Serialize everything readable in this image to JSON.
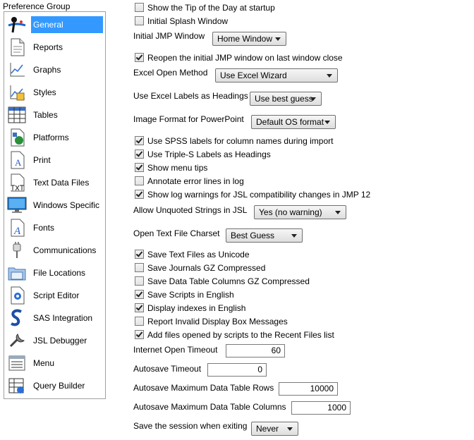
{
  "sidebar": {
    "title": "Preference Group",
    "items": [
      {
        "label": "General",
        "icon": "general-icon",
        "selected": true
      },
      {
        "label": "Reports",
        "icon": "reports-icon"
      },
      {
        "label": "Graphs",
        "icon": "graphs-icon"
      },
      {
        "label": "Styles",
        "icon": "styles-icon"
      },
      {
        "label": "Tables",
        "icon": "tables-icon"
      },
      {
        "label": "Platforms",
        "icon": "platforms-icon"
      },
      {
        "label": "Print",
        "icon": "print-icon"
      },
      {
        "label": "Text Data Files",
        "icon": "text-data-files-icon"
      },
      {
        "label": "Windows Specific",
        "icon": "windows-specific-icon"
      },
      {
        "label": "Fonts",
        "icon": "fonts-icon"
      },
      {
        "label": "Communications",
        "icon": "communications-icon"
      },
      {
        "label": "File Locations",
        "icon": "file-locations-icon"
      },
      {
        "label": "Script Editor",
        "icon": "script-editor-icon"
      },
      {
        "label": "SAS Integration",
        "icon": "sas-integration-icon"
      },
      {
        "label": "JSL Debugger",
        "icon": "jsl-debugger-icon"
      },
      {
        "label": "Menu",
        "icon": "menu-icon"
      },
      {
        "label": "Query Builder",
        "icon": "query-builder-icon"
      }
    ]
  },
  "settings": {
    "tip_of_day": {
      "label": "Show the Tip of the Day at startup",
      "checked": false
    },
    "splash": {
      "label": "Initial Splash Window",
      "checked": false
    },
    "initial_window": {
      "label": "Initial JMP Window",
      "value": "Home Window"
    },
    "reopen": {
      "label": "Reopen the initial JMP window on last window close",
      "checked": true
    },
    "excel_method": {
      "label": "Excel Open Method",
      "value": "Use Excel Wizard"
    },
    "excel_labels": {
      "label": "Use Excel Labels as Headings",
      "value": "Use best guess"
    },
    "image_format": {
      "label": "Image Format for PowerPoint",
      "value": "Default OS format"
    },
    "spss": {
      "label": "Use SPSS labels for column names during import",
      "checked": true
    },
    "triple_s": {
      "label": "Use Triple-S Labels as Headings",
      "checked": true
    },
    "menu_tips": {
      "label": "Show menu tips",
      "checked": true
    },
    "annotate": {
      "label": "Annotate error lines in log",
      "checked": false
    },
    "log_warnings": {
      "label": "Show log warnings for JSL compatibility changes in JMP 12",
      "checked": true
    },
    "unquoted": {
      "label": "Allow Unquoted Strings in JSL",
      "value": "Yes (no warning)"
    },
    "charset": {
      "label": "Open Text File Charset",
      "value": "Best Guess"
    },
    "unicode": {
      "label": "Save Text Files as Unicode",
      "checked": true
    },
    "journals_gz": {
      "label": "Save Journals GZ Compressed",
      "checked": false
    },
    "columns_gz": {
      "label": "Save Data Table Columns GZ Compressed",
      "checked": false
    },
    "scripts_english": {
      "label": "Save Scripts in English",
      "checked": true
    },
    "indexes_english": {
      "label": "Display indexes in English",
      "checked": true
    },
    "invalid_display": {
      "label": "Report Invalid Display Box Messages",
      "checked": false
    },
    "recent_files": {
      "label": "Add files opened by scripts to the Recent Files list",
      "checked": true
    },
    "internet_timeout": {
      "label": "Internet Open Timeout",
      "value": "60"
    },
    "autosave_timeout": {
      "label": "Autosave Timeout",
      "value": "0"
    },
    "autosave_rows": {
      "label": "Autosave Maximum Data Table Rows",
      "value": "10000"
    },
    "autosave_cols": {
      "label": "Autosave Maximum Data Table Columns",
      "value": "1000"
    },
    "save_session": {
      "label": "Save the session when exiting",
      "value": "Never"
    }
  }
}
